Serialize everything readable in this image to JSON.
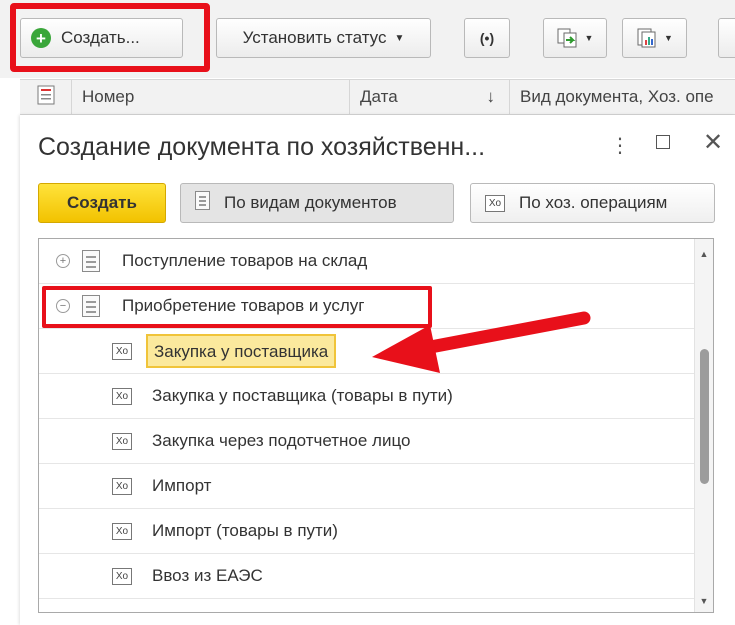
{
  "toolbar": {
    "create_label": "Создать...",
    "status_label": "Установить статус",
    "radio_label": "(•)"
  },
  "list_header": {
    "number": "Номер",
    "date": "Дата",
    "sort_arrow": "↓",
    "doc_kind": "Вид документа, Хоз. опе"
  },
  "dialog": {
    "title": "Создание документа по хозяйственн...",
    "more": "⋮",
    "close": "✕",
    "create_button": "Создать",
    "by_doc_types": "По видам документов",
    "by_operations": "По хоз. операциям",
    "op_icon_text": "Xo"
  },
  "tree": {
    "groups": [
      {
        "label": "Поступление товаров на склад",
        "expander": "+"
      },
      {
        "label": "Приобретение товаров и услуг",
        "expander": "−"
      }
    ],
    "operations": [
      {
        "label": "Закупка у поставщика",
        "selected": true
      },
      {
        "label": "Закупка у поставщика (товары в пути)"
      },
      {
        "label": "Закупка через подотчетное лицо"
      },
      {
        "label": "Импорт"
      },
      {
        "label": "Импорт (товары в пути)"
      },
      {
        "label": "Ввоз из ЕАЭС"
      }
    ]
  },
  "colors": {
    "highlight_red": "#e8101a",
    "create_yellow": "#f2c200",
    "selection_fill": "#fbe99d",
    "plus_green": "#3aa63a"
  }
}
